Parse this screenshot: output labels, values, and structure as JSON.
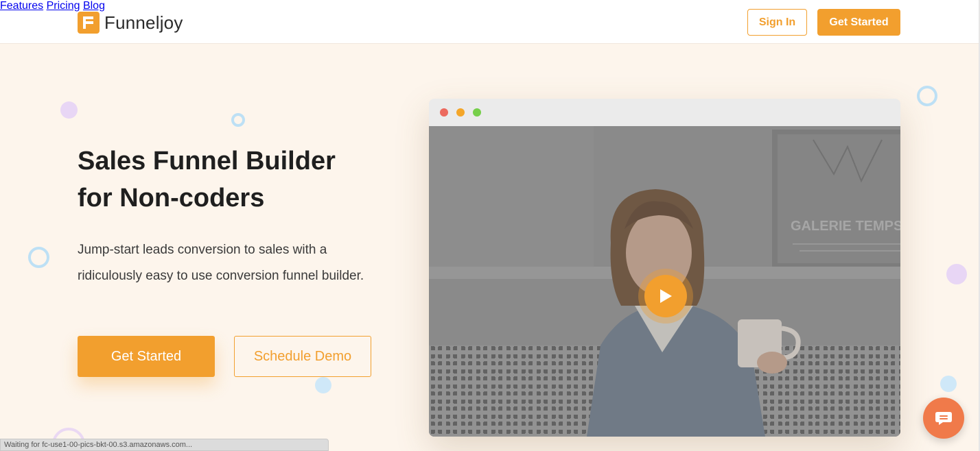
{
  "brand": {
    "name": "Funneljoy",
    "accent_color": "#f29f2e"
  },
  "nav": {
    "items": [
      {
        "label": "Features"
      },
      {
        "label": "Pricing"
      },
      {
        "label": "Blog"
      }
    ],
    "sign_in_label": "Sign In",
    "get_started_label": "Get Started"
  },
  "hero": {
    "title": "Sales Funnel Builder for Non-coders",
    "description": "Jump-start leads conversion to sales with a ridiculously easy to use conversion funnel builder.",
    "primary_cta": "Get Started",
    "secondary_cta": "Schedule Demo"
  },
  "video": {
    "sign_text": "GALERIE TEMPS",
    "play_icon": "play-icon"
  },
  "chat": {
    "icon": "chat-icon",
    "color": "#f07a4a"
  },
  "status_bar": {
    "text": "Waiting for fc-use1-00-pics-bkt-00.s3.amazonaws.com..."
  }
}
